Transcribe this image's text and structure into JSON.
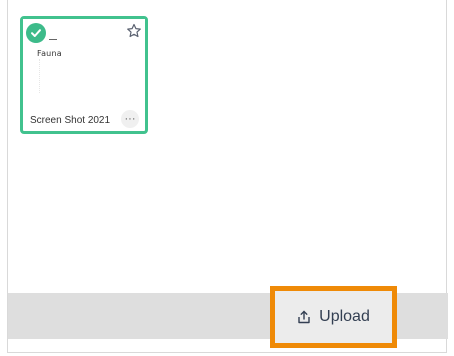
{
  "file_card": {
    "thumbnail_text": "Fauna",
    "filename": "Screen Shot 2021",
    "more_label": "···"
  },
  "footer": {
    "upload_label": "Upload"
  },
  "colors": {
    "selected_border": "#41c28e",
    "highlight_border": "#ef8a07"
  },
  "icons": {
    "selected": "check-circle-icon",
    "favorite": "star-icon",
    "more": "more-horizontal-icon",
    "upload": "upload-icon"
  }
}
